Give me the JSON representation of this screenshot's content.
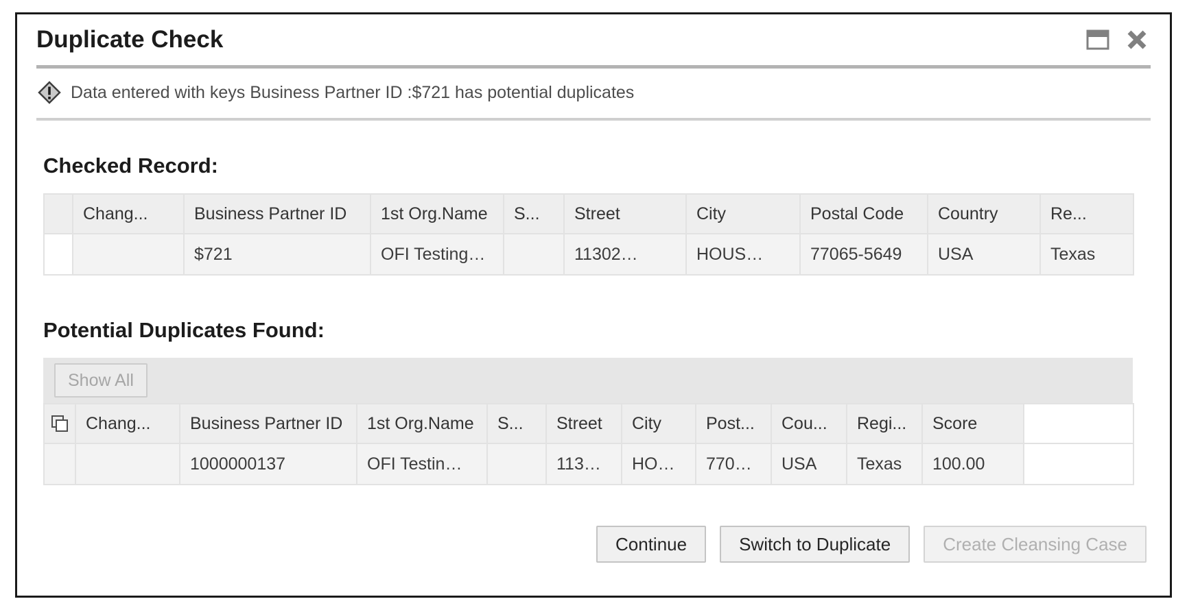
{
  "dialog": {
    "title": "Duplicate Check",
    "window_controls": [
      {
        "name": "restore-icon",
        "label": "Restore"
      },
      {
        "name": "close-icon",
        "label": "Close"
      }
    ]
  },
  "message": {
    "icon": "warning-diamond-icon",
    "text": "Data entered with keys Business Partner ID :$721 has potential duplicates"
  },
  "checked_record": {
    "heading": "Checked Record:",
    "columns": [
      "",
      "Chang...",
      "Business Partner ID",
      "1st Org.Name",
      "S...",
      "Street",
      "City",
      "Postal Code",
      "Country",
      "Re..."
    ],
    "rows": [
      {
        "select": "",
        "changed": "",
        "business_partner_id": "$721",
        "org_name": "OFI Testing…",
        "s": "",
        "street": "11302…",
        "city": "HOUS…",
        "postal_code": "77065-5649",
        "country": "USA",
        "region": "Texas"
      }
    ]
  },
  "potential_duplicates": {
    "heading": "Potential Duplicates Found:",
    "toolbar": {
      "show_all_label": "Show All",
      "show_all_enabled": false
    },
    "header_icon": "copy-stack-icon",
    "columns": [
      "",
      "Chang...",
      "Business Partner ID",
      "1st Org.Name",
      "S...",
      "Street",
      "City",
      "Post...",
      "Cou...",
      "Regi...",
      "Score"
    ],
    "rows": [
      {
        "select": "",
        "changed": "",
        "business_partner_id": "1000000137",
        "org_name": "OFI Testin…",
        "s": "",
        "street": "113…",
        "city": "HO…",
        "postal_code": "770…",
        "country": "USA",
        "region": "Texas",
        "score": "100.00"
      }
    ]
  },
  "footer": {
    "buttons": [
      {
        "label": "Continue",
        "enabled": true
      },
      {
        "label": "Switch to Duplicate",
        "enabled": true
      },
      {
        "label": "Create Cleansing Case",
        "enabled": false
      }
    ]
  },
  "colors": {
    "border": "#1a1a1a",
    "header_bg": "#eeeeee",
    "row_bg": "#f3f3f3",
    "toolbar_bg": "#e6e6e6",
    "rule": "#b3b3b3",
    "disabled_text": "#b0b0b0"
  }
}
